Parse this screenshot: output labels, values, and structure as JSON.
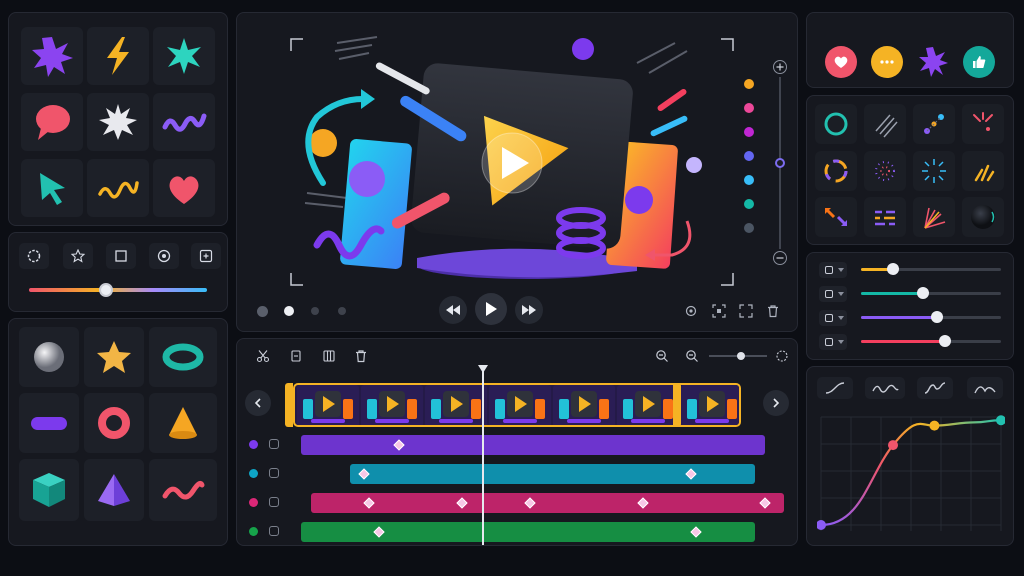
{
  "app": {
    "name": "motion-editor"
  },
  "left_panel": {
    "stickers": [
      "star-burst",
      "lightning-bolt",
      "spark-star",
      "speech-bubble",
      "white-burst",
      "purple-squiggle",
      "arrow-cursor",
      "yellow-squiggle",
      "heart"
    ],
    "toolbar_tools": [
      "circle-dashed",
      "star-outline",
      "square-outline",
      "target-circle",
      "plus-square"
    ],
    "color_slider": {
      "value": 0.43
    },
    "shapes": [
      "sphere",
      "star",
      "torus",
      "capsule",
      "donut",
      "cone",
      "cube",
      "pyramid",
      "worm"
    ]
  },
  "preview": {
    "zoom_slider": {
      "value": 0.5
    },
    "color_swatches": [
      "#f5a623",
      "#ec4899",
      "#c026d3",
      "#6366f1",
      "#38bdf8",
      "#14b8a6",
      "#4b5563"
    ],
    "page_dots": {
      "count": 4,
      "active": 1
    }
  },
  "timeline": {
    "zoom": {
      "value": 0.55
    },
    "clip_count": 7,
    "playhead": {
      "value": 0.37
    },
    "tracks": [
      {
        "color": "#7c3aed",
        "start": 0.0,
        "end": 0.95,
        "keyframes": [
          0.2
        ]
      },
      {
        "color": "#0ea5c6",
        "start": 0.1,
        "end": 0.93,
        "keyframes": [
          0.13,
          0.8
        ]
      },
      {
        "color": "#db2777",
        "start": 0.02,
        "end": 0.99,
        "keyframes": [
          0.14,
          0.33,
          0.47,
          0.7,
          0.95
        ]
      },
      {
        "color": "#16a34a",
        "start": 0.0,
        "end": 0.93,
        "keyframes": [
          0.16,
          0.81
        ]
      }
    ]
  },
  "right_panel": {
    "reactions": [
      "heart",
      "chat-bubble",
      "spark",
      "thumbs-up"
    ],
    "effects": [
      "ring",
      "speed-lines",
      "dotted-arc",
      "sparkle-burst",
      "gradient-ring",
      "dotted-ring",
      "radial-burst",
      "confetti",
      "arrows-out",
      "dash-lines",
      "fan-lines",
      "dark-orb"
    ],
    "properties": [
      {
        "icon": "opacity",
        "color": "#f5b324",
        "value": 0.23
      },
      {
        "icon": "scale",
        "color": "#14b8a6",
        "value": 0.44
      },
      {
        "icon": "position",
        "color": "#8b5cf6",
        "value": 0.54
      },
      {
        "icon": "rotation",
        "color": "#f43f5e",
        "value": 0.6
      }
    ],
    "easing_presets": [
      "ease-in-out",
      "wave",
      "ease-out-step",
      "bounce"
    ],
    "curve": {
      "points": [
        [
          0.0,
          0.0
        ],
        [
          0.4,
          0.74
        ],
        [
          0.63,
          0.92
        ],
        [
          0.85,
          0.95
        ],
        [
          1.0,
          0.97
        ]
      ]
    }
  }
}
